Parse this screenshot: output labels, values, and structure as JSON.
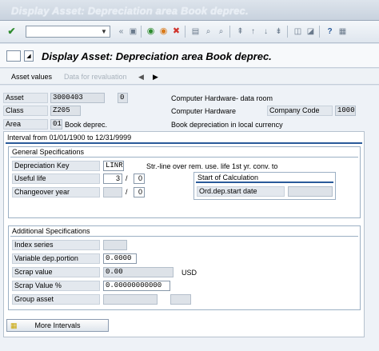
{
  "window": {
    "title": "Display Asset: Depreciation area Book deprec."
  },
  "toolbar": {
    "command_value": ""
  },
  "screen": {
    "title": "Display Asset: Depreciation area Book deprec."
  },
  "app_toolbar": {
    "asset_values": "Asset values",
    "data_for_revaluation": "Data for revaluation"
  },
  "header": {
    "asset_label": "Asset",
    "asset_value": "3000403",
    "asset_sub": "0",
    "asset_desc": "Computer Hardware- data room",
    "class_label": "Class",
    "class_value": "Z205",
    "class_desc": "Computer Hardware",
    "company_code_label": "Company Code",
    "company_code_value": "1000",
    "area_label": "Area",
    "area_value": "01",
    "area_name": "Book deprec.",
    "area_desc": "Book depreciation in local currency"
  },
  "interval": {
    "text": "Interval from 01/01/1900 to 12/31/9999"
  },
  "general": {
    "title": "General Specifications",
    "dep_key_label": "Depreciation Key",
    "dep_key_value": "LINR",
    "dep_key_desc": "Str.-line over rem. use. life 1st yr. conv. to",
    "useful_life_label": "Useful life",
    "useful_life_years": "3",
    "useful_life_periods": "0",
    "changeover_label": "Changeover year",
    "changeover_year": "",
    "changeover_period": "0",
    "start_calc_title": "Start of Calculation",
    "ord_dep_label": "Ord.dep.start date",
    "ord_dep_value": "",
    "slash": "/"
  },
  "additional": {
    "title": "Additional Specifications",
    "index_series_label": "Index series",
    "index_series_value": "",
    "var_dep_label": "Variable dep.portion",
    "var_dep_value": "0.0000",
    "scrap_value_label": "Scrap value",
    "scrap_value_value": "0.00",
    "currency": "USD",
    "scrap_pct_label": "Scrap Value %",
    "scrap_pct_value": "0.00000000000",
    "group_asset_label": "Group asset",
    "group_asset_value": "",
    "group_asset_sub": ""
  },
  "buttons": {
    "more_intervals": "More Intervals"
  },
  "colors": {
    "group_line": "#2a5a9a",
    "check_green": "#2e8b2e",
    "cancel_red": "#d0342c"
  }
}
